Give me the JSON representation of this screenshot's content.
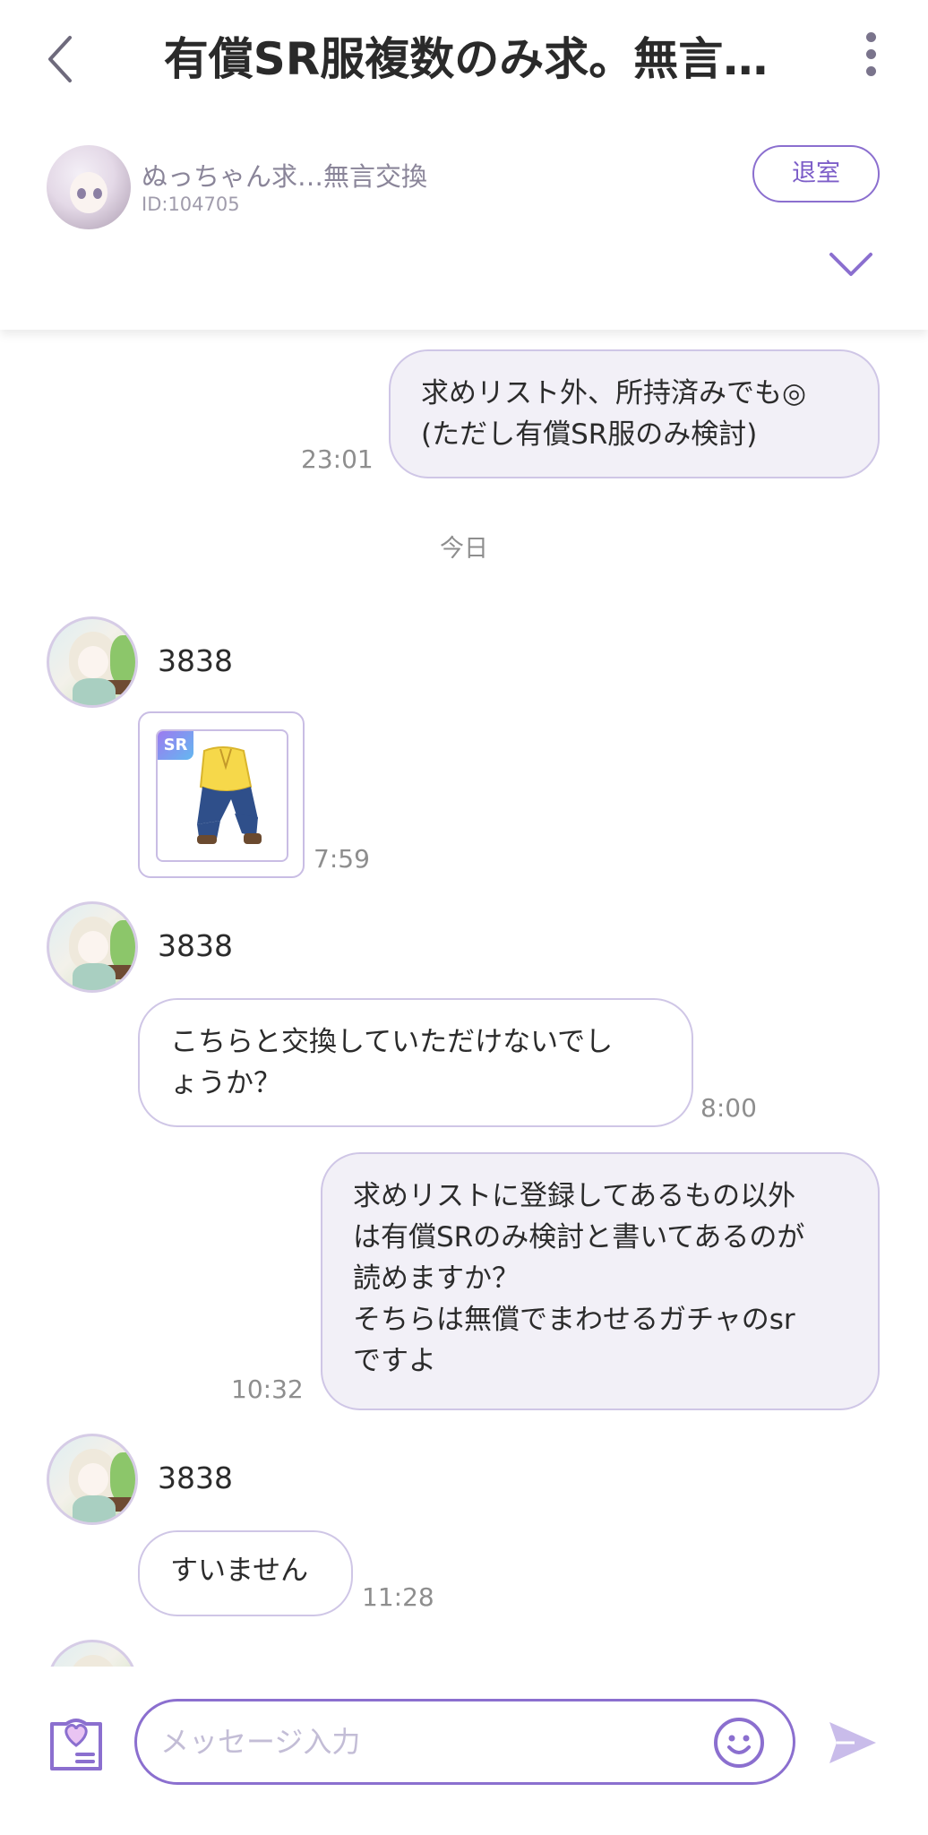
{
  "header": {
    "title": "有償SR服複数のみ求。無言…",
    "room_host_name": "ぬっちゃん求…無言交換",
    "room_id": "ID:104705",
    "leave_label": "退室"
  },
  "messages": {
    "m1": {
      "text": "求めリスト外、所持済みでも◎\n(ただし有償SR服のみ検討)",
      "time": "23:01"
    },
    "day_separator": "今日",
    "m2": {
      "sender": "3838",
      "time": "7:59",
      "item_badge": "SR"
    },
    "m3": {
      "sender": "3838",
      "text": "こちらと交換していただけないでし\nょうか？",
      "time": "8:00"
    },
    "m4": {
      "text": "求めリストに登録してあるもの以外\nは有償SRのみ検討と書いてあるのが\n読めますか？\nそちらは無償でまわせるガチャのsr\nですよ",
      "time": "10:32"
    },
    "m5": {
      "sender": "3838",
      "text": "すいません",
      "time": "11:28"
    }
  },
  "input": {
    "placeholder": "メッセージ入力"
  },
  "colors": {
    "accent": "#8b6fcf",
    "bubble_border": "#cfc6e6",
    "mine_bubble_bg": "#f2f0f7",
    "send_icon": "#c9bcea"
  }
}
